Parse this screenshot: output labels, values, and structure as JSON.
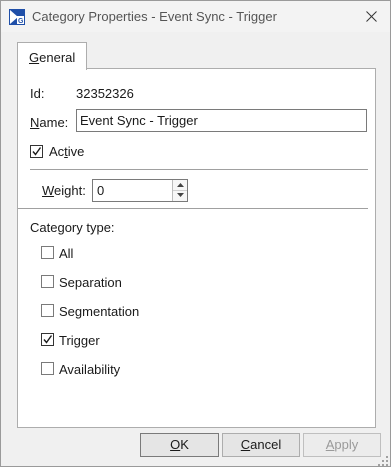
{
  "window": {
    "title": "Category Properties - Event Sync - Trigger"
  },
  "tabs": [
    {
      "label_prefix": "",
      "label_mnemonic": "G",
      "label_rest": "eneral"
    }
  ],
  "general": {
    "id_label": "Id:",
    "id_value": "32352326",
    "name_label_mnemonic": "N",
    "name_label_rest": "ame:",
    "name_value": "Event Sync - Trigger",
    "active_label_prefix": "Ac",
    "active_label_mnemonic": "t",
    "active_label_rest": "ive",
    "active_checked": true,
    "weight_label_mnemonic": "W",
    "weight_label_rest": "eight:",
    "weight_value": "0",
    "category_type_label": "Category type:",
    "category_types": [
      {
        "label": "All",
        "checked": false
      },
      {
        "label": "Separation",
        "checked": false
      },
      {
        "label": "Segmentation",
        "checked": false
      },
      {
        "label": "Trigger",
        "checked": true
      },
      {
        "label": "Availability",
        "checked": false
      }
    ]
  },
  "buttons": {
    "ok_mnemonic": "O",
    "ok_rest": "K",
    "cancel_mnemonic": "C",
    "cancel_rest": "ancel",
    "apply_mnemonic": "A",
    "apply_rest": "pply"
  },
  "colors": {
    "icon_blue": "#1f4fa8",
    "check_mark": "#1a1a1a"
  },
  "icons": [
    "app-icon",
    "close-icon",
    "check-icon",
    "spin-up-icon",
    "spin-down-icon",
    "resize-grip-icon"
  ]
}
